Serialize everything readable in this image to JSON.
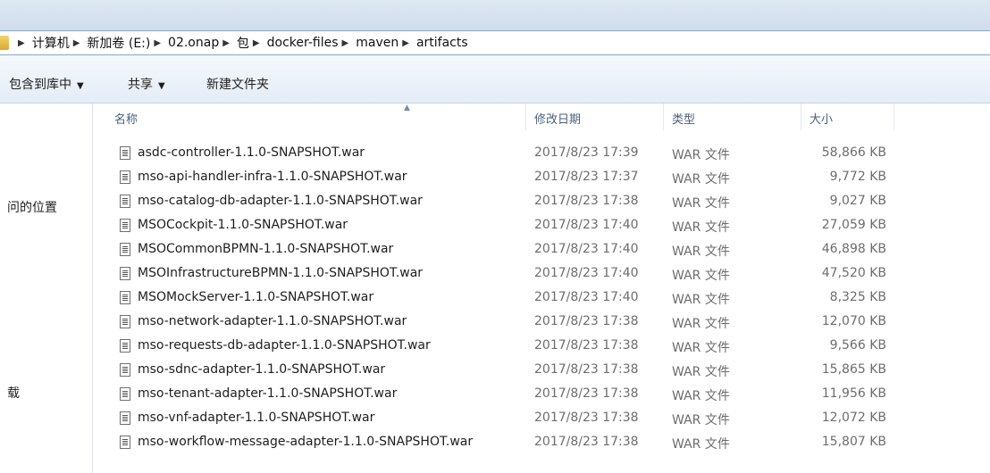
{
  "address_bar": {
    "crumbs": [
      "计算机",
      "新加卷 (E:)",
      "02.onap",
      "包",
      "docker-files",
      "maven",
      "artifacts"
    ]
  },
  "toolbar": {
    "include_label": "包含到库中",
    "share_label": "共享",
    "new_folder_label": "新建文件夹"
  },
  "sidebar": {
    "items": [
      "问的位置",
      "载"
    ]
  },
  "columns": {
    "name": "名称",
    "date": "修改日期",
    "type": "类型",
    "size": "大小"
  },
  "files": [
    {
      "name": "asdc-controller-1.1.0-SNAPSHOT.war",
      "date": "2017/8/23 17:39",
      "type": "WAR 文件",
      "size": "58,866 KB"
    },
    {
      "name": "mso-api-handler-infra-1.1.0-SNAPSHOT.war",
      "date": "2017/8/23 17:37",
      "type": "WAR 文件",
      "size": "9,772 KB"
    },
    {
      "name": "mso-catalog-db-adapter-1.1.0-SNAPSHOT.war",
      "date": "2017/8/23 17:38",
      "type": "WAR 文件",
      "size": "9,027 KB"
    },
    {
      "name": "MSOCockpit-1.1.0-SNAPSHOT.war",
      "date": "2017/8/23 17:40",
      "type": "WAR 文件",
      "size": "27,059 KB"
    },
    {
      "name": "MSOCommonBPMN-1.1.0-SNAPSHOT.war",
      "date": "2017/8/23 17:40",
      "type": "WAR 文件",
      "size": "46,898 KB"
    },
    {
      "name": "MSOInfrastructureBPMN-1.1.0-SNAPSHOT.war",
      "date": "2017/8/23 17:40",
      "type": "WAR 文件",
      "size": "47,520 KB"
    },
    {
      "name": "MSOMockServer-1.1.0-SNAPSHOT.war",
      "date": "2017/8/23 17:40",
      "type": "WAR 文件",
      "size": "8,325 KB"
    },
    {
      "name": "mso-network-adapter-1.1.0-SNAPSHOT.war",
      "date": "2017/8/23 17:38",
      "type": "WAR 文件",
      "size": "12,070 KB"
    },
    {
      "name": "mso-requests-db-adapter-1.1.0-SNAPSHOT.war",
      "date": "2017/8/23 17:38",
      "type": "WAR 文件",
      "size": "9,566 KB"
    },
    {
      "name": "mso-sdnc-adapter-1.1.0-SNAPSHOT.war",
      "date": "2017/8/23 17:38",
      "type": "WAR 文件",
      "size": "15,865 KB"
    },
    {
      "name": "mso-tenant-adapter-1.1.0-SNAPSHOT.war",
      "date": "2017/8/23 17:38",
      "type": "WAR 文件",
      "size": "11,956 KB"
    },
    {
      "name": "mso-vnf-adapter-1.1.0-SNAPSHOT.war",
      "date": "2017/8/23 17:38",
      "type": "WAR 文件",
      "size": "12,072 KB"
    },
    {
      "name": "mso-workflow-message-adapter-1.1.0-SNAPSHOT.war",
      "date": "2017/8/23 17:38",
      "type": "WAR 文件",
      "size": "15,807 KB"
    }
  ]
}
